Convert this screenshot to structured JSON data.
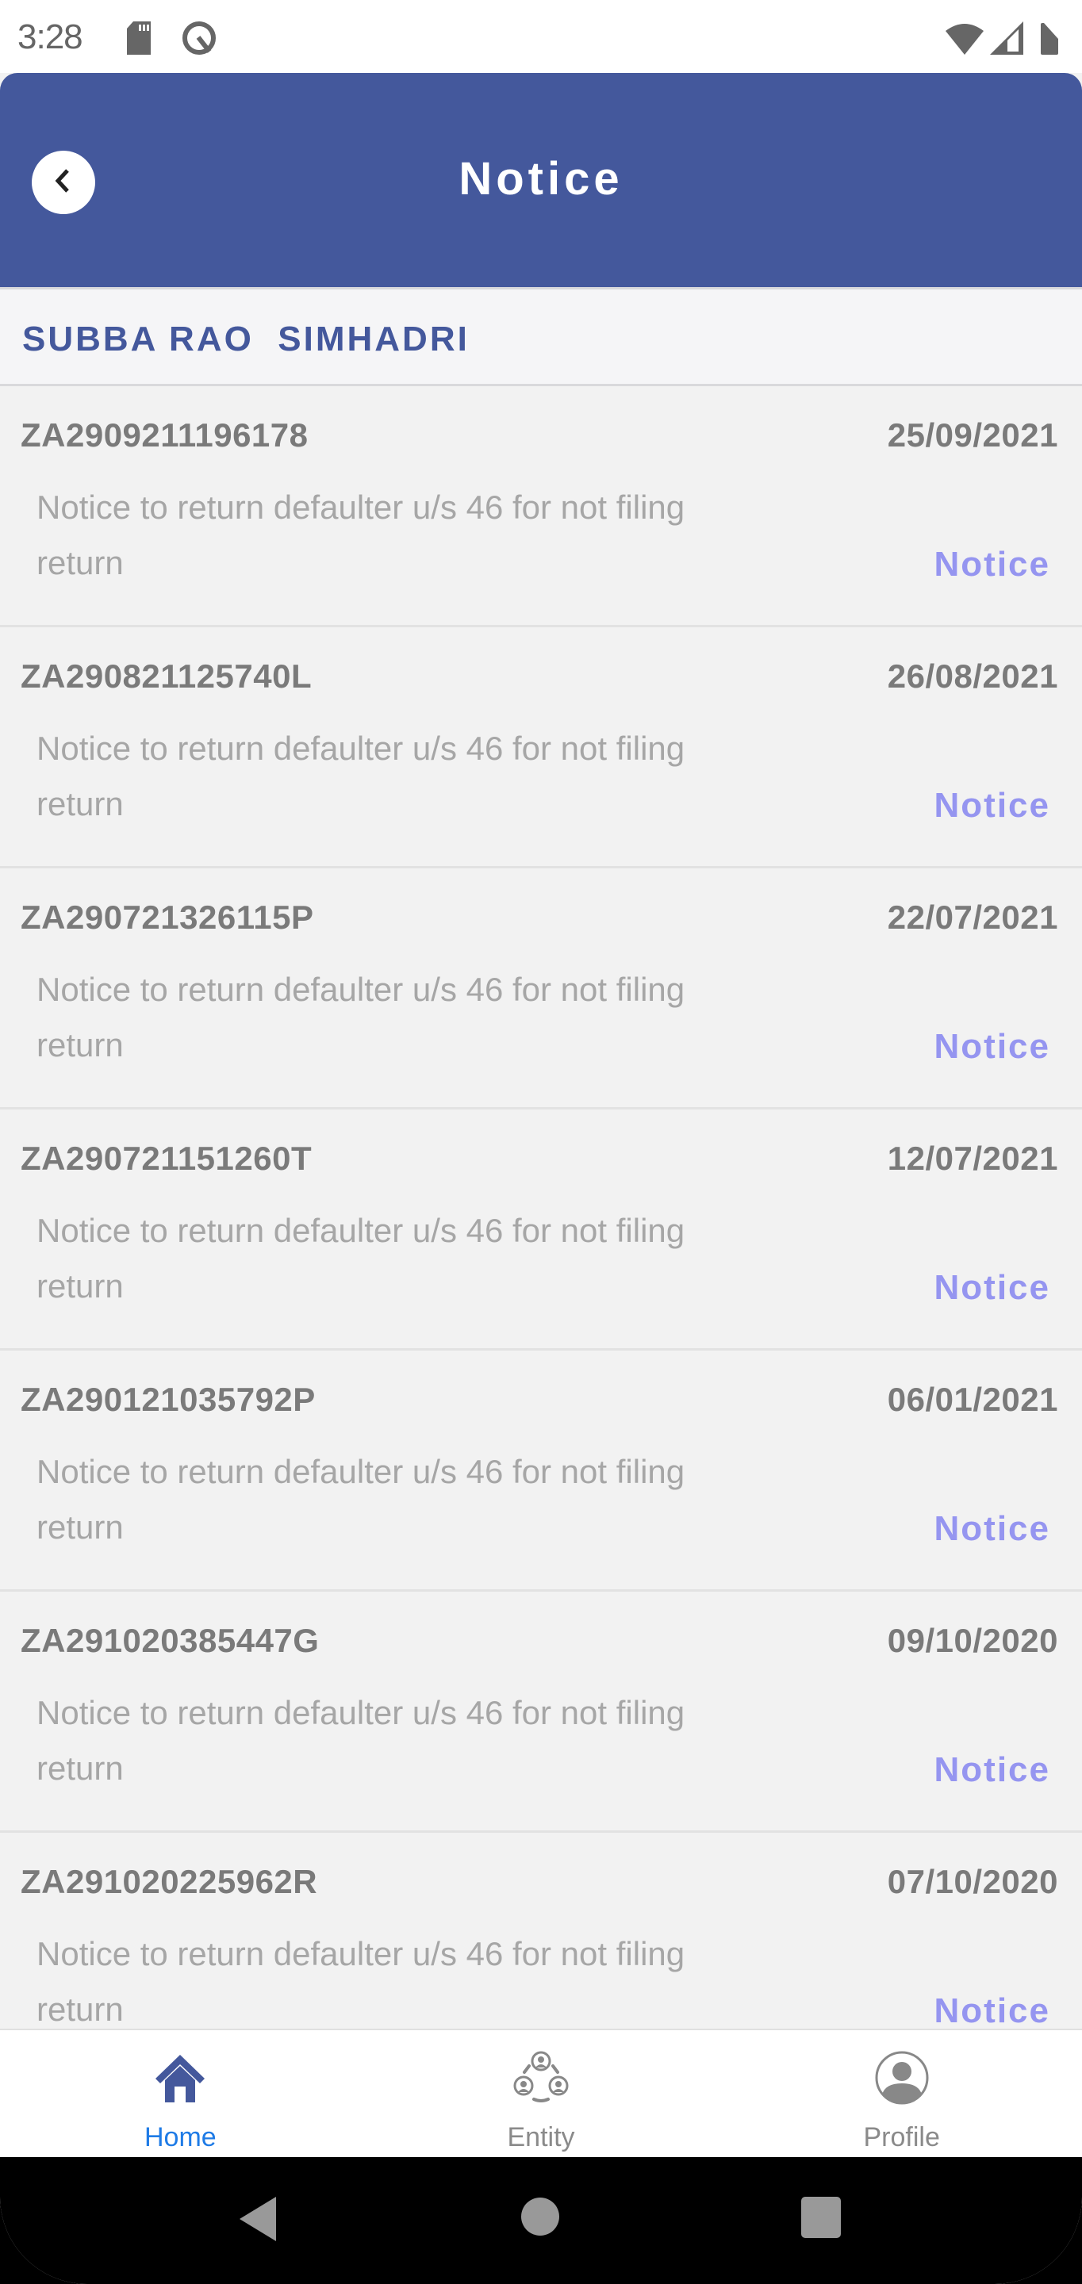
{
  "status_bar": {
    "time": "3:28",
    "icons": [
      "sd-card-icon",
      "data-saver-icon",
      "wifi-icon",
      "cell-signal-icon",
      "battery-icon"
    ]
  },
  "header": {
    "title": "Notice",
    "back_icon": "chevron-left-icon",
    "background_color": "#44589c"
  },
  "taxpayer": {
    "name": "SUBBA RAO  SIMHADRI"
  },
  "notices": [
    {
      "id": "ZA2909211196178",
      "date": "25/09/2021",
      "description": "Notice to return defaulter u/s 46 for not filing return",
      "type_label": "Notice"
    },
    {
      "id": "ZA290821125740L",
      "date": "26/08/2021",
      "description": "Notice to return defaulter u/s 46 for not filing return",
      "type_label": "Notice"
    },
    {
      "id": "ZA290721326115P",
      "date": "22/07/2021",
      "description": "Notice to return defaulter u/s 46 for not filing return",
      "type_label": "Notice"
    },
    {
      "id": "ZA290721151260T",
      "date": "12/07/2021",
      "description": "Notice to return defaulter u/s 46 for not filing return",
      "type_label": "Notice"
    },
    {
      "id": "ZA290121035792P",
      "date": "06/01/2021",
      "description": "Notice to return defaulter u/s 46 for not filing return",
      "type_label": "Notice"
    },
    {
      "id": "ZA291020385447G",
      "date": "09/10/2020",
      "description": "Notice to return defaulter u/s 46 for not filing return",
      "type_label": "Notice"
    },
    {
      "id": "ZA291020225962R",
      "date": "07/10/2020",
      "description": "Notice to return defaulter u/s 46 for not filing return",
      "type_label": "Notice"
    }
  ],
  "bottom_nav": {
    "items": [
      {
        "label": "Home",
        "icon": "home-icon",
        "active": true
      },
      {
        "label": "Entity",
        "icon": "entity-group-icon",
        "active": false
      },
      {
        "label": "Profile",
        "icon": "profile-icon",
        "active": false
      }
    ]
  },
  "colors": {
    "accent": "#44589c",
    "link": "#9595f0",
    "active_tab": "#1e7be6",
    "muted_text": "#a6a6a6",
    "id_text": "#7a7a7a"
  }
}
